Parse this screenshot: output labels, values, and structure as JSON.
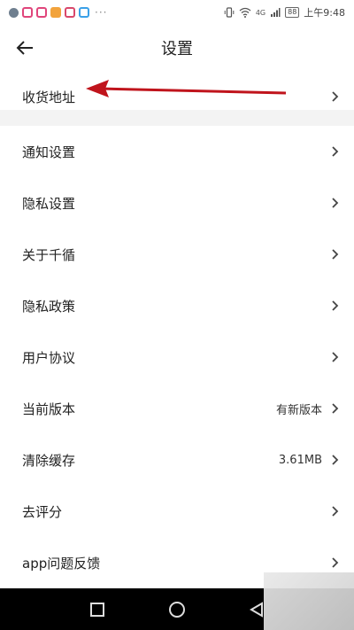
{
  "status_bar": {
    "time": "上午9:48",
    "battery": "88",
    "network": "4G",
    "notification_colors": [
      "#6f7f8f",
      "#e0457b",
      "#e0457b",
      "#f2a33c",
      "#d9486b",
      "#3aa0e8"
    ]
  },
  "header": {
    "title": "设置",
    "back_icon": "arrow-left-icon"
  },
  "menu": {
    "address": "收货地址",
    "items": [
      {
        "label": "通知设置",
        "value": ""
      },
      {
        "label": "隐私设置",
        "value": ""
      },
      {
        "label": "关于千循",
        "value": ""
      },
      {
        "label": "隐私政策",
        "value": ""
      },
      {
        "label": "用户协议",
        "value": ""
      },
      {
        "label": "当前版本",
        "value": "有新版本"
      },
      {
        "label": "清除缓存",
        "value": "3.61MB"
      },
      {
        "label": "去评分",
        "value": ""
      },
      {
        "label": "app问题反馈",
        "value": ""
      }
    ]
  },
  "annotation": {
    "color": "#c0141c"
  },
  "nav_bar": {
    "buttons": [
      "square-icon",
      "circle-icon",
      "triangle-icon"
    ]
  }
}
